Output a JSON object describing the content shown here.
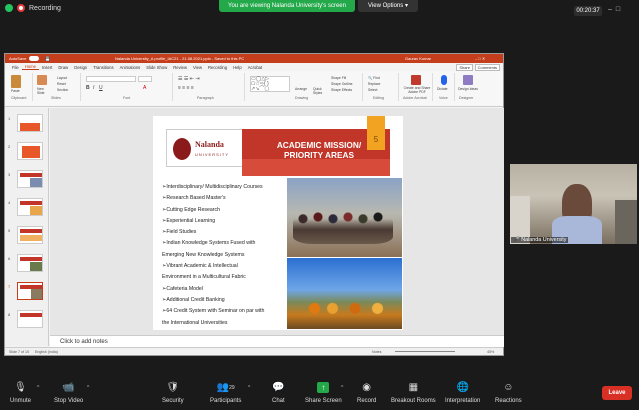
{
  "zoom": {
    "recording_label": "Recording",
    "banner": "You are viewing Nalanda University's screen",
    "view_options": "View Options",
    "timer": "00:20:37",
    "toolbar": [
      {
        "id": "unmute",
        "label": "Unmute",
        "icon": "mic-off-icon"
      },
      {
        "id": "video",
        "label": "Stop Video",
        "icon": "camera-icon"
      },
      {
        "id": "security",
        "label": "Security",
        "icon": "shield-icon"
      },
      {
        "id": "participants",
        "label": "Participants",
        "icon": "people-icon",
        "count": "29"
      },
      {
        "id": "chat",
        "label": "Chat",
        "icon": "chat-icon"
      },
      {
        "id": "share",
        "label": "Share Screen",
        "icon": "share-icon"
      },
      {
        "id": "record",
        "label": "Record",
        "icon": "record-icon"
      },
      {
        "id": "breakout",
        "label": "Breakout Rooms",
        "icon": "grid-icon"
      },
      {
        "id": "interp",
        "label": "Interpretation",
        "icon": "globe-icon"
      },
      {
        "id": "reactions",
        "label": "Reactions",
        "icon": "smile-icon"
      }
    ],
    "leave": "Leave",
    "video_name": "Nalanda University"
  },
  "ppt": {
    "autosave": "AutoSave",
    "doc_title": "Nalanda University_A profile_IAC21 - 21.08.2021.pptx - Saved to this PC",
    "user": "Gaurav Kumar",
    "menu": [
      "File",
      "Home",
      "Insert",
      "Draw",
      "Design",
      "Transitions",
      "Animations",
      "Slide Show",
      "Review",
      "View",
      "Recording",
      "Help",
      "Acrobat"
    ],
    "share": "Share",
    "comments": "Comments",
    "ribbon": {
      "paste": "Paste",
      "clipboard": "Clipboard",
      "new_slide": "New Slide",
      "reuse": "Reuse Slides",
      "layout": "Layout",
      "reset": "Reset",
      "section": "Section",
      "slides": "Slides",
      "font": "Font",
      "paragraph": "Paragraph",
      "drawing": "Drawing",
      "arrange": "Arrange",
      "quick_styles": "Quick Styles",
      "shape_fill": "Shape Fill",
      "shape_outline": "Shape Outline",
      "shape_effects": "Shape Effects",
      "find": "Find",
      "replace": "Replace",
      "select": "Select",
      "editing": "Editing",
      "adobe": "Create and Share Adobe PDF",
      "adobe_group": "Adobe Acrobat",
      "dictate": "Dictate",
      "voice": "Voice",
      "designer": "Design Ideas",
      "designer_group": "Designer"
    },
    "slide": {
      "logo_name": "Nalanda",
      "logo_sub": "UNIVERSITY",
      "title_line1": "ACADEMIC MISSION/",
      "title_line2": "PRIORITY AREAS",
      "number": "5",
      "bullets": [
        "➢Interdisciplinary/ Multidisciplinary Courses",
        "➢Research Based Master's",
        "➢Cutting Edge Research",
        "➢Experiential Learning",
        "➢Field Studies",
        "➢Indian Knowledge Systems Fused with",
        "Emerging New Knowledge Systems",
        "➢Vibrant Academic & Intellectual",
        "Environment in a Multicultural Fabric",
        "➢Cafeteria Model",
        "➢Additional Credit Banking",
        "➢64 Credit System with Seminar on par with",
        "the International Universities"
      ]
    },
    "notes": "Click to add notes",
    "status_slide": "Slide 7 of 15",
    "status_lang": "English (India)",
    "status_notes": "Notes",
    "status_zoom": "45%",
    "thumbs": [
      "1",
      "2",
      "3",
      "4",
      "5",
      "6",
      "7",
      "8"
    ]
  }
}
